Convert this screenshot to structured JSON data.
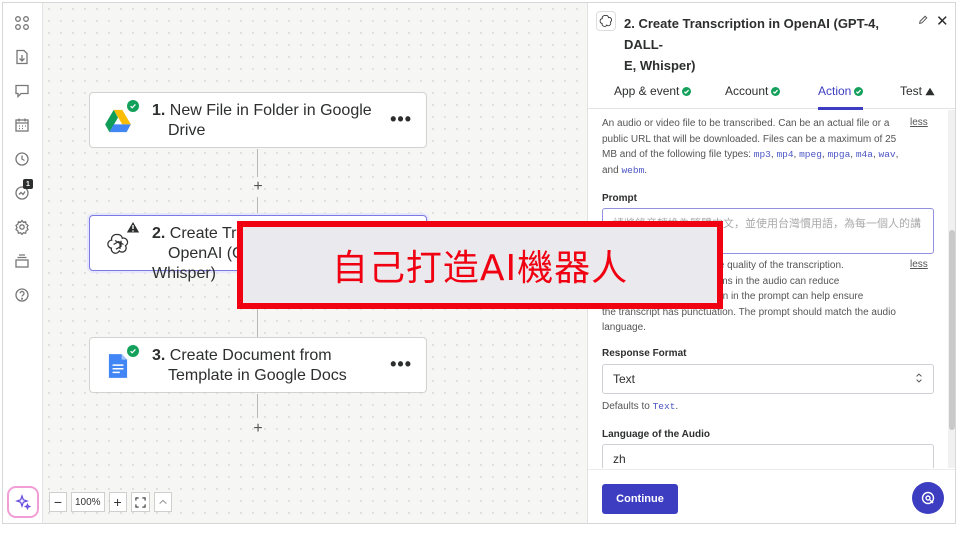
{
  "canvas": {
    "steps": [
      {
        "number": "1.",
        "line1": "New File in Folder in Google",
        "line2": "Drive",
        "status": "ok",
        "more": "•••"
      },
      {
        "number": "2.",
        "line1": "Create Transcription in",
        "line2": "OpenAI (GPT-4, DALL-E, Whisper)",
        "status": "warning",
        "more": "•••"
      },
      {
        "number": "3.",
        "line1": "Create Document from",
        "line2": "Template in Google Docs",
        "status": "ok",
        "more": "•••"
      }
    ],
    "plus_label": "+",
    "zoom": {
      "minus": "−",
      "value": "100%",
      "plus": "+"
    }
  },
  "rail": {
    "notification_count": "1"
  },
  "panel": {
    "title_line1": "2. Create Transcription in OpenAI (GPT-4, DALL-",
    "title_line2": "E, Whisper)",
    "edit_icon": "pencil-icon",
    "close_label": "✕",
    "tabs": [
      {
        "label": "App & event",
        "status": "ok"
      },
      {
        "label": "Account",
        "status": "ok"
      },
      {
        "label": "Action",
        "status": "ok",
        "active": true
      },
      {
        "label": "Test",
        "status": "warning"
      }
    ],
    "file_help": {
      "line1": "An audio or video file to be transcribed. Can be an actual file or a",
      "line2": "public URL that will be downloaded. Files can be a maximum of 25",
      "line3": "MB and of the following file types:",
      "types": [
        "mp3",
        "mp4",
        "mpeg",
        "mpga",
        "m4a",
        "wav"
      ],
      "and_word": "and",
      "last_type": "webm",
      "less": "less"
    },
    "prompt": {
      "label": "Prompt",
      "value": "請將錄音轉換為繁體中文，並使用台灣慣用語，為每一個人的講",
      "help_line1": "Optional text to improve the quality of the transcription.",
      "help_line2": "Including names or acronyms in the audio can reduce",
      "help_line3": "errors. Including punctuation in the prompt can help ensure",
      "help_line4": "the transcript has punctuation. The prompt should match the audio",
      "help_line5": "language.",
      "less": "less"
    },
    "response_format": {
      "label": "Response Format",
      "value": "Text",
      "defaults_prefix": "Defaults to",
      "defaults_value": "Text",
      "defaults_suffix": "."
    },
    "language": {
      "label": "Language of the Audio",
      "value": "zh"
    },
    "continue_label": "Continue"
  },
  "banner": {
    "text": "自己打造AI機器人"
  },
  "colors": {
    "accent": "#3d3dc2",
    "success": "#13a05a",
    "banner_red": "#f00010"
  }
}
